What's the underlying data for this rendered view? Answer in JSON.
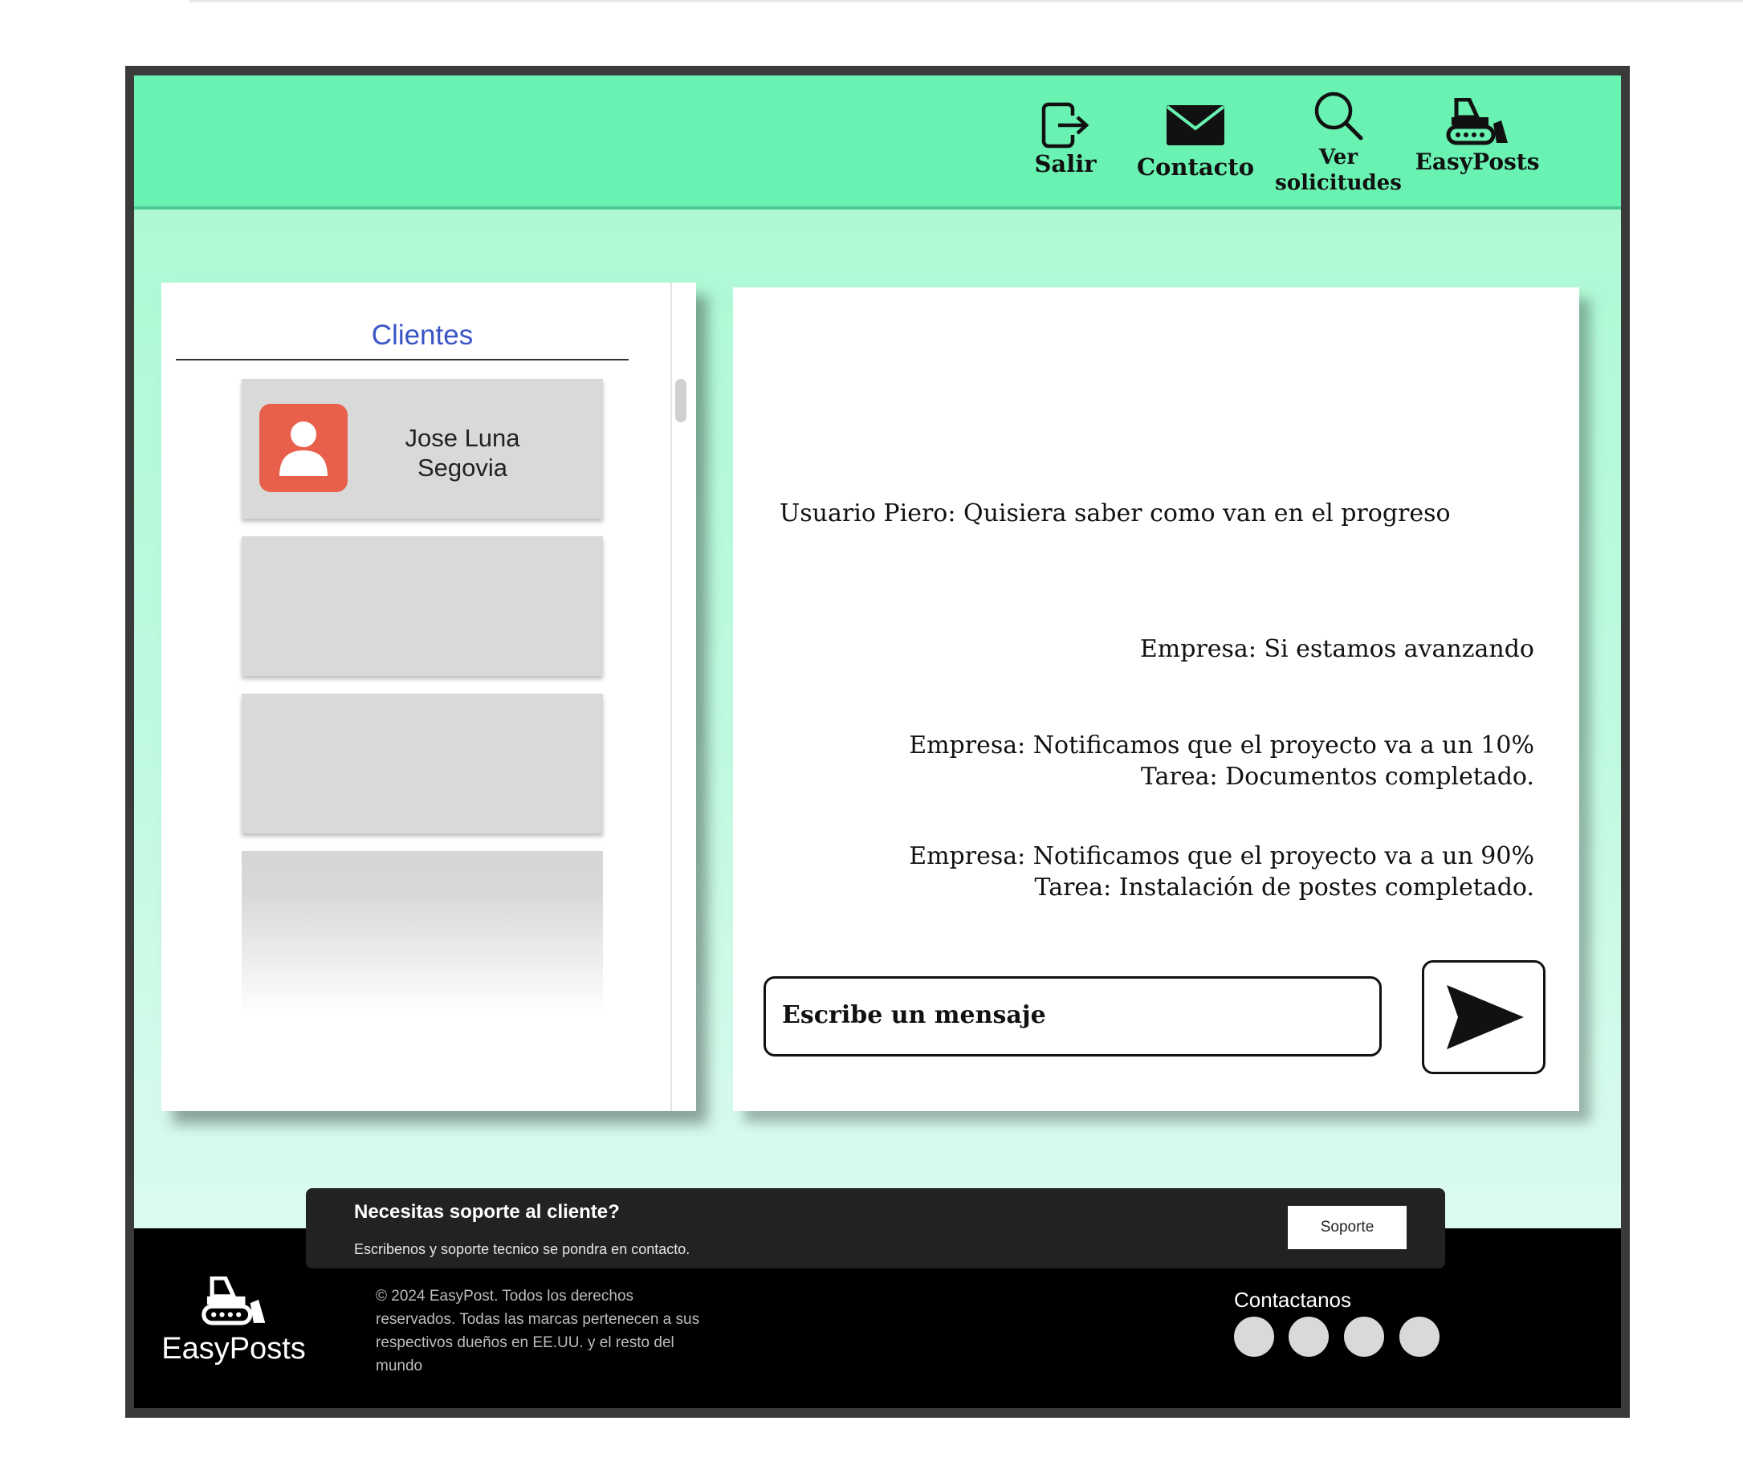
{
  "header": {
    "nav": [
      {
        "label": "Salir",
        "icon": "logout-icon"
      },
      {
        "label": "Contacto",
        "icon": "envelope-icon"
      },
      {
        "label": "Ver solicitudes",
        "icon": "search-icon"
      },
      {
        "label": "EasyPosts",
        "icon": "bulldozer-icon"
      }
    ],
    "bg_color": "#69f2b1"
  },
  "clients": {
    "title": "Clientes",
    "items": [
      {
        "name": "Jose Luna Segovia",
        "avatar_color": "#e8604c"
      },
      {
        "name": ""
      },
      {
        "name": ""
      },
      {
        "name": ""
      }
    ]
  },
  "chat": {
    "messages": [
      {
        "text": "Usuario Piero: Quisiera saber como van en el progreso",
        "align": "left"
      },
      {
        "text": "Empresa: Si estamos avanzando",
        "align": "right"
      },
      {
        "line1": "Empresa: Notificamos que el proyecto va a un 10%",
        "line2": "Tarea: Documentos completado.",
        "align": "right"
      },
      {
        "line1": "Empresa: Notificamos que el proyecto va a un 90%",
        "line2": "Tarea: Instalación de postes completado.",
        "align": "right"
      }
    ],
    "input_placeholder": "Escribe un mensaje",
    "send_icon": "send-icon"
  },
  "support": {
    "title": "Necesitas soporte al cliente?",
    "subtitle": "Escribenos y soporte tecnico se pondra en contacto.",
    "button": "Soporte"
  },
  "footer": {
    "brand": "EasyPosts",
    "copyright": "© 2024 EasyPost. Todos los derechos reservados. Todas las marcas pertenecen a sus respectivos dueños en EE.UU. y el resto del mundo",
    "contact_title": "Contactanos",
    "social_count": 4
  }
}
